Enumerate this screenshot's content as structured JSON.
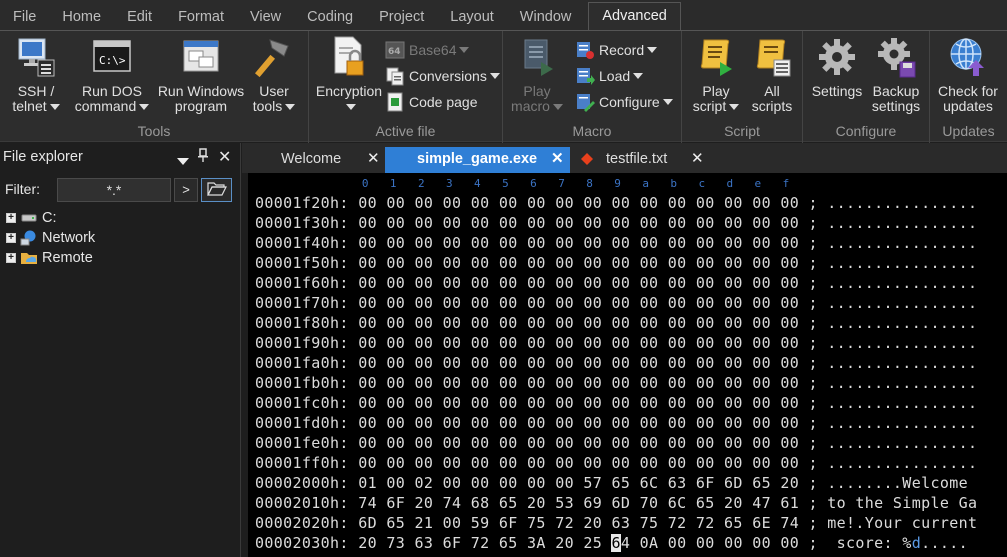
{
  "menu": {
    "tabs": [
      "File",
      "Home",
      "Edit",
      "Format",
      "View",
      "Coding",
      "Project",
      "Layout",
      "Window",
      "Advanced"
    ],
    "active": "Advanced"
  },
  "ribbon": {
    "tools": {
      "label": "Tools",
      "ssh": [
        "SSH /",
        "telnet"
      ],
      "dos": [
        "Run DOS",
        "command"
      ],
      "win": [
        "Run Windows",
        "program"
      ],
      "user": [
        "User",
        "tools"
      ]
    },
    "active_file": {
      "label": "Active file",
      "encryption": "Encryption",
      "base64": "Base64",
      "conversions": "Conversions",
      "code_page": "Code page"
    },
    "macro": {
      "label": "Macro",
      "play": [
        "Play",
        "macro"
      ],
      "record": "Record",
      "load": "Load",
      "configure": "Configure"
    },
    "script": {
      "label": "Script",
      "play": [
        "Play",
        "script"
      ],
      "all": [
        "All",
        "scripts"
      ]
    },
    "configure": {
      "label": "Configure",
      "settings": "Settings",
      "backup": [
        "Backup",
        "settings"
      ]
    },
    "updates": {
      "label": "Updates",
      "check": [
        "Check for",
        "updates"
      ]
    }
  },
  "file_explorer": {
    "title": "File explorer",
    "filter_label": "Filter:",
    "filter_value": "*.*",
    "go": ">",
    "tree": [
      "C:",
      "Network",
      "Remote"
    ]
  },
  "doc_tabs": [
    "Welcome",
    "simple_game.exe",
    "testfile.txt"
  ],
  "hex": {
    "ruler": [
      "0",
      "1",
      "2",
      "3",
      "4",
      "5",
      "6",
      "7",
      "8",
      "9",
      "a",
      "b",
      "c",
      "d",
      "e",
      "f"
    ],
    "rows": [
      {
        "addr": "00001f20h:",
        "bytes": "00 00 00 00 00 00 00 00 00 00 00 00 00 00 00 00",
        "ascii": "................"
      },
      {
        "addr": "00001f30h:",
        "bytes": "00 00 00 00 00 00 00 00 00 00 00 00 00 00 00 00",
        "ascii": "................"
      },
      {
        "addr": "00001f40h:",
        "bytes": "00 00 00 00 00 00 00 00 00 00 00 00 00 00 00 00",
        "ascii": "................"
      },
      {
        "addr": "00001f50h:",
        "bytes": "00 00 00 00 00 00 00 00 00 00 00 00 00 00 00 00",
        "ascii": "................"
      },
      {
        "addr": "00001f60h:",
        "bytes": "00 00 00 00 00 00 00 00 00 00 00 00 00 00 00 00",
        "ascii": "................"
      },
      {
        "addr": "00001f70h:",
        "bytes": "00 00 00 00 00 00 00 00 00 00 00 00 00 00 00 00",
        "ascii": "................"
      },
      {
        "addr": "00001f80h:",
        "bytes": "00 00 00 00 00 00 00 00 00 00 00 00 00 00 00 00",
        "ascii": "................"
      },
      {
        "addr": "00001f90h:",
        "bytes": "00 00 00 00 00 00 00 00 00 00 00 00 00 00 00 00",
        "ascii": "................"
      },
      {
        "addr": "00001fa0h:",
        "bytes": "00 00 00 00 00 00 00 00 00 00 00 00 00 00 00 00",
        "ascii": "................"
      },
      {
        "addr": "00001fb0h:",
        "bytes": "00 00 00 00 00 00 00 00 00 00 00 00 00 00 00 00",
        "ascii": "................"
      },
      {
        "addr": "00001fc0h:",
        "bytes": "00 00 00 00 00 00 00 00 00 00 00 00 00 00 00 00",
        "ascii": "................"
      },
      {
        "addr": "00001fd0h:",
        "bytes": "00 00 00 00 00 00 00 00 00 00 00 00 00 00 00 00",
        "ascii": "................"
      },
      {
        "addr": "00001fe0h:",
        "bytes": "00 00 00 00 00 00 00 00 00 00 00 00 00 00 00 00",
        "ascii": "................"
      },
      {
        "addr": "00001ff0h:",
        "bytes": "00 00 00 00 00 00 00 00 00 00 00 00 00 00 00 00",
        "ascii": "................"
      },
      {
        "addr": "00002000h:",
        "bytes": "01 00 02 00 00 00 00 00 57 65 6C 63 6F 6D 65 20",
        "ascii": "........Welcome "
      },
      {
        "addr": "00002010h:",
        "bytes": "74 6F 20 74 68 65 20 53 69 6D 70 6C 65 20 47 61",
        "ascii": "to the Simple Ga"
      },
      {
        "addr": "00002020h:",
        "bytes": "6D 65 21 00 59 6F 75 72 20 63 75 72 72 65 6E 74",
        "ascii": "me!.Your current"
      },
      {
        "addr": "00002030h:",
        "bytes_pre": "20 73 63 6F 72 65 3A 20 25 ",
        "bytes_hl": "6",
        "bytes_post": "4 0A 00 00 00 00 00",
        "ascii_pre": " score: %",
        "ascii_blue": "d",
        "ascii_post": "....."
      }
    ]
  }
}
